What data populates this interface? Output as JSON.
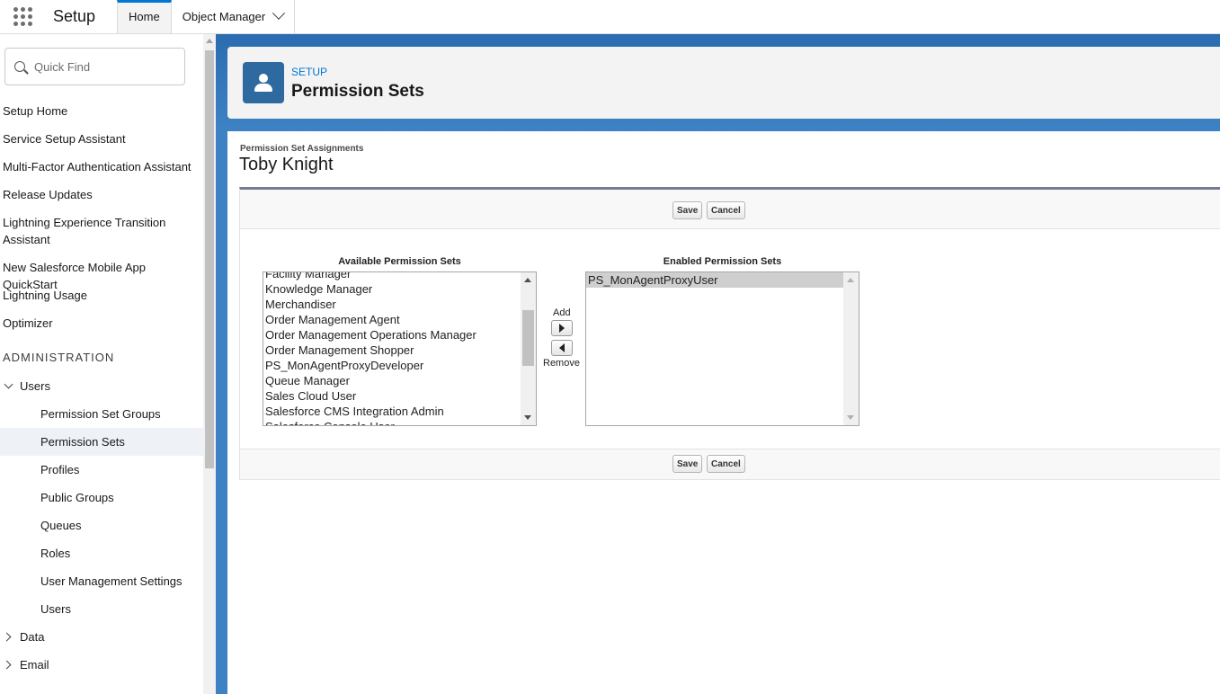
{
  "topnav": {
    "app_name": "Setup",
    "tabs": [
      {
        "label": "Home",
        "active": true
      },
      {
        "label": "Object Manager",
        "active": false
      }
    ]
  },
  "sidebar": {
    "quick_find_placeholder": "Quick Find",
    "items": [
      {
        "label": "Setup Home"
      },
      {
        "label": "Service Setup Assistant"
      },
      {
        "label": "Multi-Factor Authentication Assistant"
      },
      {
        "label": "Release Updates"
      },
      {
        "label": "Lightning Experience Transition Assistant"
      },
      {
        "label": "New Salesforce Mobile App QuickStart"
      },
      {
        "label": "Lightning Usage"
      },
      {
        "label": "Optimizer"
      }
    ],
    "section_heading": "ADMINISTRATION",
    "users_group": {
      "label": "Users",
      "children": [
        {
          "label": "Permission Set Groups"
        },
        {
          "label": "Permission Sets",
          "active": true
        },
        {
          "label": "Profiles"
        },
        {
          "label": "Public Groups"
        },
        {
          "label": "Queues"
        },
        {
          "label": "Roles"
        },
        {
          "label": "User Management Settings"
        },
        {
          "label": "Users"
        }
      ]
    },
    "collapsed_groups": [
      {
        "label": "Data"
      },
      {
        "label": "Email"
      }
    ]
  },
  "header": {
    "eyebrow": "SETUP",
    "title": "Permission Sets"
  },
  "assignment": {
    "label": "Permission Set Assignments",
    "user_name": "Toby Knight",
    "save_label": "Save",
    "cancel_label": "Cancel",
    "available_label": "Available Permission Sets",
    "enabled_label": "Enabled Permission Sets",
    "add_label": "Add",
    "remove_label": "Remove",
    "available_options": [
      "Facility Manager",
      "Knowledge Manager",
      "Merchandiser",
      "Order Management Agent",
      "Order Management Operations Manager",
      "Order Management Shopper",
      "PS_MonAgentProxyDeveloper",
      "Queue Manager",
      "Sales Cloud User",
      "Salesforce CMS Integration Admin",
      "Salesforce Console User"
    ],
    "enabled_options": [
      "PS_MonAgentProxyUser"
    ]
  }
}
